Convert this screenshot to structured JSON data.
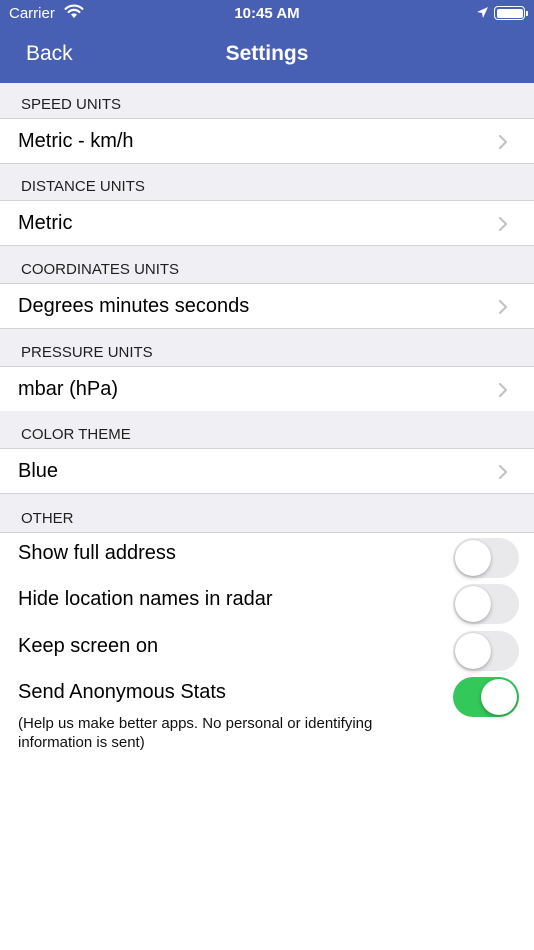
{
  "status_bar": {
    "carrier": "Carrier",
    "time": "10:45 AM",
    "icons": [
      "wifi-icon",
      "location-icon",
      "battery-icon"
    ]
  },
  "nav": {
    "back_label": "Back",
    "title": "Settings"
  },
  "colors": {
    "nav_bar": "#4860b4",
    "toggle_on": "#34c759",
    "toggle_off": "#e9e9eb",
    "section_bg": "#f0f0f4"
  },
  "sections": [
    {
      "header": "SPEED UNITS",
      "value": "Metric - km/h"
    },
    {
      "header": "DISTANCE UNITS",
      "value": "Metric"
    },
    {
      "header": "COORDINATES UNITS",
      "value": "Degrees minutes seconds"
    },
    {
      "header": "PRESSURE UNITS",
      "value": "mbar (hPa)"
    },
    {
      "header": "COLOR THEME",
      "value": "Blue"
    }
  ],
  "other": {
    "header": "OTHER",
    "toggles": [
      {
        "label": "Show full address",
        "on": false
      },
      {
        "label": "Hide location names in radar",
        "on": false
      },
      {
        "label": "Keep screen on",
        "on": false
      },
      {
        "label": "Send Anonymous Stats",
        "on": true
      }
    ],
    "note": "(Help us make better apps. No personal or identifying information is sent)"
  }
}
